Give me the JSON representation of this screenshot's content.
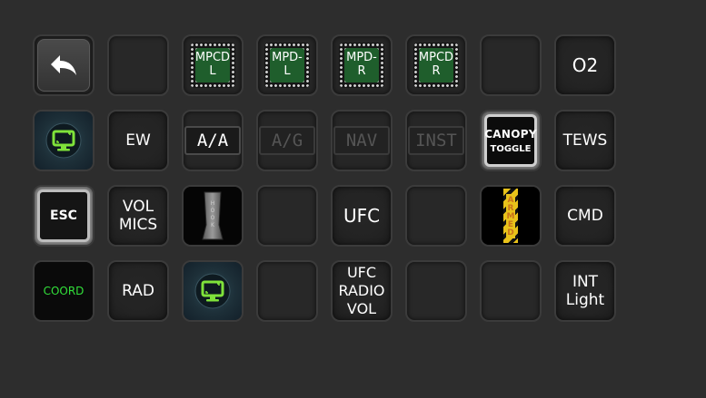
{
  "keys": [
    {
      "type": "back",
      "name": "back-button",
      "icon": "back-arrow-icon"
    },
    {
      "type": "empty",
      "name": "empty-key"
    },
    {
      "type": "chip",
      "name": "mpcd-l-button",
      "label": "MPCD\nL"
    },
    {
      "type": "chip",
      "name": "mpd-l-button",
      "label": "MPD-L"
    },
    {
      "type": "chip",
      "name": "mpd-r-button",
      "label": "MPD-R"
    },
    {
      "type": "chip",
      "name": "mpcd-r-button",
      "label": "MPCD\nR"
    },
    {
      "type": "empty",
      "name": "empty-key"
    },
    {
      "type": "plain",
      "name": "o2-button",
      "label": "O2",
      "size": "lg"
    },
    {
      "type": "monitor",
      "name": "display-profile-button",
      "icon": "monitor-icon"
    },
    {
      "type": "plain",
      "name": "ew-button",
      "label": "EW",
      "size": "md"
    },
    {
      "type": "panel",
      "name": "mode-aa-button",
      "label": "A/A",
      "state": "on"
    },
    {
      "type": "panel",
      "name": "mode-ag-button",
      "label": "A/G",
      "state": "off"
    },
    {
      "type": "panel",
      "name": "mode-nav-button",
      "label": "NAV",
      "state": "off"
    },
    {
      "type": "panel",
      "name": "mode-inst-button",
      "label": "INST",
      "state": "off"
    },
    {
      "type": "canopy",
      "name": "canopy-toggle-button",
      "label1": "CANOPY",
      "label2": "TOGGLE"
    },
    {
      "type": "plain",
      "name": "tews-button",
      "label": "TEWS",
      "size": "md"
    },
    {
      "type": "esc",
      "name": "esc-button",
      "label": "ESC"
    },
    {
      "type": "plain",
      "name": "vol-mics-button",
      "label": "VOL\nMICS",
      "size": "md"
    },
    {
      "type": "hook",
      "name": "hook-button",
      "icon": "hook-handle-icon"
    },
    {
      "type": "empty",
      "name": "empty-key"
    },
    {
      "type": "plain",
      "name": "ufc-button",
      "label": "UFC",
      "size": "lg"
    },
    {
      "type": "empty",
      "name": "empty-key"
    },
    {
      "type": "armed",
      "name": "armed-button",
      "label": "ARMED"
    },
    {
      "type": "plain",
      "name": "cmd-button",
      "label": "CMD",
      "size": "md"
    },
    {
      "type": "coord",
      "name": "coord-button",
      "label": "COORD"
    },
    {
      "type": "plain",
      "name": "rad-button",
      "label": "RAD",
      "size": "md"
    },
    {
      "type": "monitor",
      "name": "display-profile-button-2",
      "icon": "monitor-icon"
    },
    {
      "type": "empty",
      "name": "empty-key"
    },
    {
      "type": "plain",
      "name": "ufc-radio-vol-button",
      "label": "UFC\nRADIO\nVOL",
      "size": "sm"
    },
    {
      "type": "empty",
      "name": "empty-key"
    },
    {
      "type": "empty",
      "name": "empty-key"
    },
    {
      "type": "plain",
      "name": "int-light-button",
      "label": "INT\nLight",
      "size": "md"
    }
  ],
  "colors": {
    "background": "#2d2d2d",
    "chip_green": "#1f5e2c",
    "coord_green": "#32e03a",
    "monitor_green": "#7fe23a",
    "armed_yellow": "#e8c21a"
  }
}
